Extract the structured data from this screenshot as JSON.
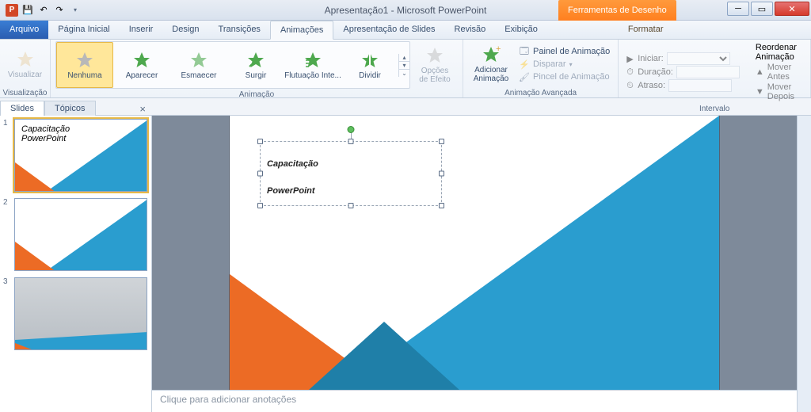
{
  "app": {
    "title": "Apresentação1 - Microsoft PowerPoint",
    "context_tool": "Ferramentas de Desenho"
  },
  "qat": {
    "save": "💾",
    "undo": "↶",
    "redo": "↷"
  },
  "tabs": {
    "file": "Arquivo",
    "list": [
      "Página Inicial",
      "Inserir",
      "Design",
      "Transições",
      "Animações",
      "Apresentação de Slides",
      "Revisão",
      "Exibição"
    ],
    "active": "Animações",
    "context": "Formatar"
  },
  "ribbon": {
    "preview": {
      "btn": "Visualizar",
      "group": "Visualização"
    },
    "animation": {
      "group": "Animação",
      "items": [
        "Nenhuma",
        "Aparecer",
        "Esmaecer",
        "Surgir",
        "Flutuação Inte...",
        "Dividir"
      ],
      "options": "Opções\nde Efeito"
    },
    "advanced": {
      "group": "Animação Avançada",
      "add": "Adicionar\nAnimação",
      "pane": "Painel de Animação",
      "trigger": "Disparar",
      "painter": "Pincel de Animação"
    },
    "timing": {
      "group": "Intervalo",
      "start": "Iniciar:",
      "duration": "Duração:",
      "delay": "Atraso:",
      "reorder": "Reordenar Animação",
      "before": "Mover Antes",
      "after": "Mover Depois"
    }
  },
  "panel": {
    "slides": "Slides",
    "topics": "Tópicos"
  },
  "slide": {
    "line1": "Capacitação",
    "line2": "PowerPoint",
    "mini1": "Capacitação",
    "mini2": "PowerPoint"
  },
  "notes": {
    "placeholder": "Clique para adicionar anotações"
  },
  "thumbs": {
    "count": 3,
    "selected": 1
  },
  "colors": {
    "blue": "#2a9dcf",
    "orange": "#ec6b25"
  }
}
